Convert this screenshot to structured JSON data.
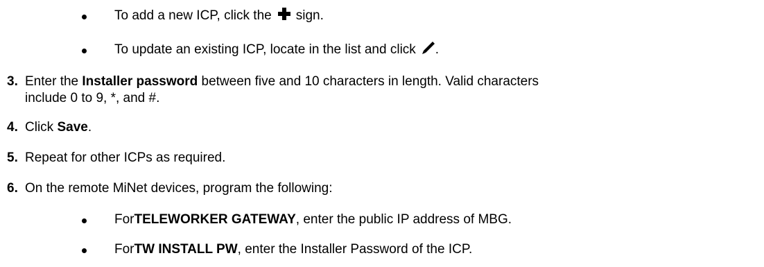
{
  "bullets_top": [
    {
      "before": "To add a new ICP, click the",
      "icon": "plus-icon",
      "after": "sign."
    },
    {
      "before": "To update an existing ICP, locate in the list and click",
      "icon": "pencil-icon",
      "after": "."
    }
  ],
  "steps": [
    {
      "number": "3.",
      "pre": "Enter the ",
      "bold": "Installer password",
      "post": " between five and 10 characters in length. Valid characters",
      "line2": "include 0 to 9, *, and #."
    },
    {
      "number": "4.",
      "pre": "Click ",
      "bold": "Save",
      "post": "."
    },
    {
      "number": "5.",
      "text": "Repeat for other ICPs as required."
    },
    {
      "number": "6.",
      "text": "On the remote MiNet devices, program the following:"
    }
  ],
  "bullets_bottom": [
    {
      "pre": "For ",
      "bold": "TELEWORKER GATEWAY",
      "post": ", enter the public IP address of MBG."
    },
    {
      "pre": "For ",
      "bold": "TW INSTALL PW",
      "post": ", enter the Installer Password of the ICP."
    }
  ]
}
